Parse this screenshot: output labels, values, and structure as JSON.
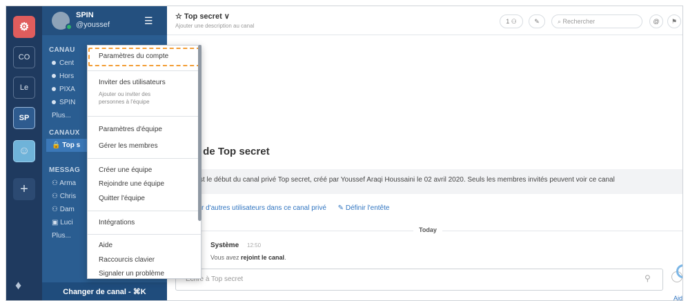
{
  "rail": {
    "teams": [
      {
        "label": "CO",
        "active": false
      },
      {
        "label": "Le",
        "active": false
      },
      {
        "label": "SP",
        "active": true
      }
    ],
    "add_label": "+"
  },
  "sidebar": {
    "team_name": "SPIN",
    "username": "@youssef",
    "section_channels": "CANAU",
    "channels": [
      "Cent",
      "Hors",
      "PIXA",
      "SPIN"
    ],
    "more_1": "Plus...",
    "section_private": "CANAUX",
    "private_active": "Top s",
    "section_messages": "MESSAG",
    "dms": [
      "Arma",
      "Chris",
      "Dam",
      "Luci"
    ],
    "more_2": "Plus...",
    "switch_channel": "Changer de canal - ⌘K"
  },
  "dropdown": {
    "account_settings": "Paramètres du compte",
    "invite_users": "Inviter des utilisateurs",
    "invite_sub_1": "Ajouter ou inviter des",
    "invite_sub_2": "personnes à l'équipe",
    "team_settings": "Paramètres d'équipe",
    "manage_members": "Gérer les membres",
    "create_team": "Créer une équipe",
    "join_team": "Rejoindre une équipe",
    "leave_team": "Quitter l'équipe",
    "integrations": "Intégrations",
    "help": "Aide",
    "shortcuts": "Raccourcis clavier",
    "report_problem": "Signaler un problème"
  },
  "header": {
    "channel_title": "☆ Top secret ∨",
    "channel_desc": "Ajouter une description au canal",
    "members_count": "1",
    "search_placeholder": "Rechercher"
  },
  "main": {
    "intro_title": ": de Top secret",
    "intro_text": "st le début du canal privé Top secret, créé par Youssef Araqi Houssaini le 02 avril 2020. Seuls les membres invités peuvent voir ce canal",
    "add_users_link": "r d'autres utilisateurs dans ce canal privé",
    "define_header_link": "Définir l'entête",
    "today": "Today",
    "message_author": "Système",
    "message_time": "12:50",
    "message_prefix": "Vous avez ",
    "message_bold": "rejoint le canal",
    "message_suffix": ".",
    "composer_placeholder": "Écrire à Top secret",
    "help_link": "Aide"
  },
  "colors": {
    "rail": "#1f3a5f",
    "sidebar": "#2a5d91",
    "highlight": "#f39c34",
    "link": "#2f74c0"
  }
}
